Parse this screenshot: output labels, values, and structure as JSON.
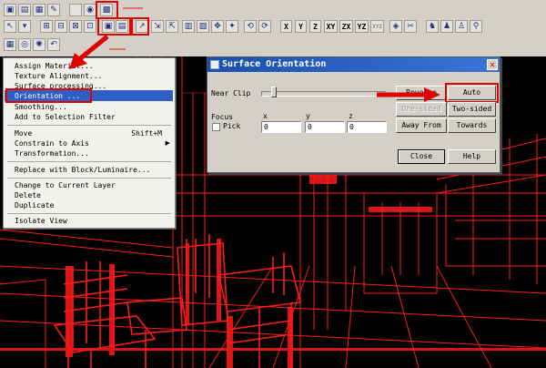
{
  "toolbar": {
    "axis_buttons": [
      "X",
      "Y",
      "Z",
      "XY",
      "ZX",
      "YZ",
      "XYZ"
    ]
  },
  "menu": {
    "items": [
      {
        "label": "Assign Material..."
      },
      {
        "label": "Texture Alignment..."
      },
      {
        "label": "Surface processing..."
      },
      {
        "label": "Orientation ..."
      },
      {
        "label": "Smoothing..."
      },
      {
        "label": "Add to Selection Filter"
      },
      {
        "label": "Move",
        "shortcut": "Shift+M"
      },
      {
        "label": "Constrain to Axis"
      },
      {
        "label": "Transformation..."
      },
      {
        "label": "Replace with Block/Luminaire..."
      },
      {
        "label": "Change to Current Layer"
      },
      {
        "label": "Delete"
      },
      {
        "label": "Duplicate"
      },
      {
        "label": "Isolate View"
      }
    ]
  },
  "dialog": {
    "title": "Surface Orientation",
    "near_clip_label": "Near Clip",
    "focus_label": "Focus",
    "pick_label": "Pick",
    "x_label": "x",
    "y_label": "y",
    "z_label": "z",
    "x_value": "0",
    "y_value": "0",
    "z_value": "0",
    "reverse_label": "Reverse",
    "auto_orient_label": "Auto Orient",
    "one_sided_label": "One-sided",
    "two_sided_label": "Two-sided",
    "away_from_label": "Away From",
    "towards_label": "Towards",
    "close_label": "Close",
    "help_label": "Help"
  },
  "colors": {
    "highlight": "#e00000",
    "menu_selected": "#2f5ec4",
    "wireframe": "#ff1a1a"
  }
}
